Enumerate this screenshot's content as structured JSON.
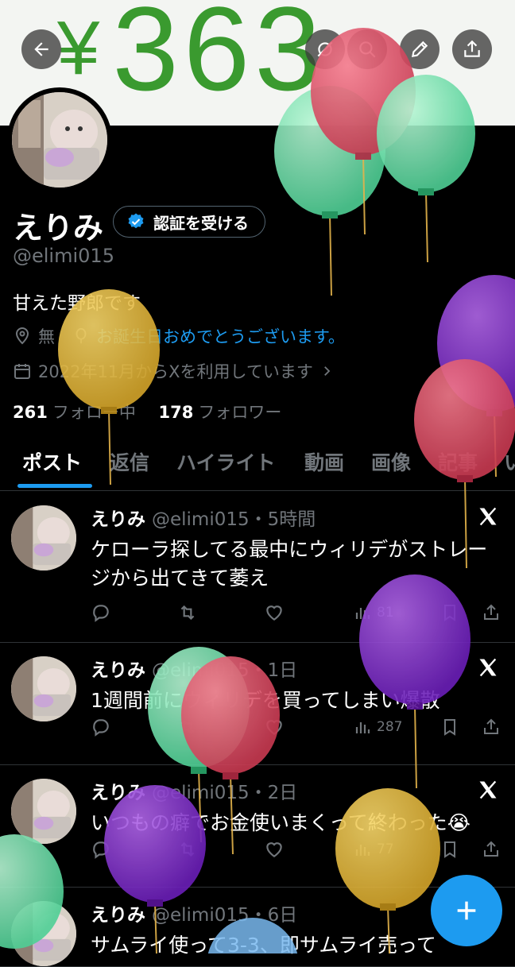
{
  "banner": {
    "yen": "¥",
    "amount": "363"
  },
  "header": {
    "back_label": "back",
    "actions": [
      "mute",
      "search",
      "edit",
      "share"
    ]
  },
  "profile": {
    "name": "えりみ",
    "verify_label": "認証を受ける",
    "handle": "@elimi015",
    "bio": "甘えた野郎です",
    "location": "無",
    "birthday_message": "お誕生日おめでとうございます。",
    "joined": "2022年11月からXを利用しています",
    "following_count": "261",
    "following_label": "フォロー中",
    "followers_count": "178",
    "followers_label": "フォロワー"
  },
  "tabs": [
    "ポスト",
    "返信",
    "ハイライト",
    "動画",
    "画像",
    "記事",
    "い"
  ],
  "tweets": [
    {
      "name": "えりみ",
      "meta": "@elimi015・5時間",
      "text": "ケローラ探してる最中にウィリデがストレージから出てきて萎え",
      "views": "81"
    },
    {
      "name": "えりみ",
      "meta": "@elimi015・1日",
      "text": "1週間前にウィリデを買ってしまい爆散",
      "views": "287"
    },
    {
      "name": "えりみ",
      "meta": "@elimi015・2日",
      "text": "いつもの癖でお金使いまくって終わった😭",
      "views": "77"
    },
    {
      "name": "えりみ",
      "meta": "@elimi015・6日",
      "text": "サムライ使って3-3、即サムライ売って",
      "views": ""
    }
  ],
  "colors": {
    "accent": "#1d9bf0",
    "background": "#000000",
    "banner_text": "#3a9a2f"
  },
  "icons": [
    "back-arrow-icon",
    "mute-icon",
    "search-icon",
    "edit-icon",
    "share-icon",
    "verified-badge-icon",
    "location-icon",
    "balloon-icon",
    "calendar-icon",
    "x-logo-icon",
    "reply-icon",
    "retweet-icon",
    "like-icon",
    "views-icon",
    "bookmark-icon",
    "compose-icon"
  ]
}
